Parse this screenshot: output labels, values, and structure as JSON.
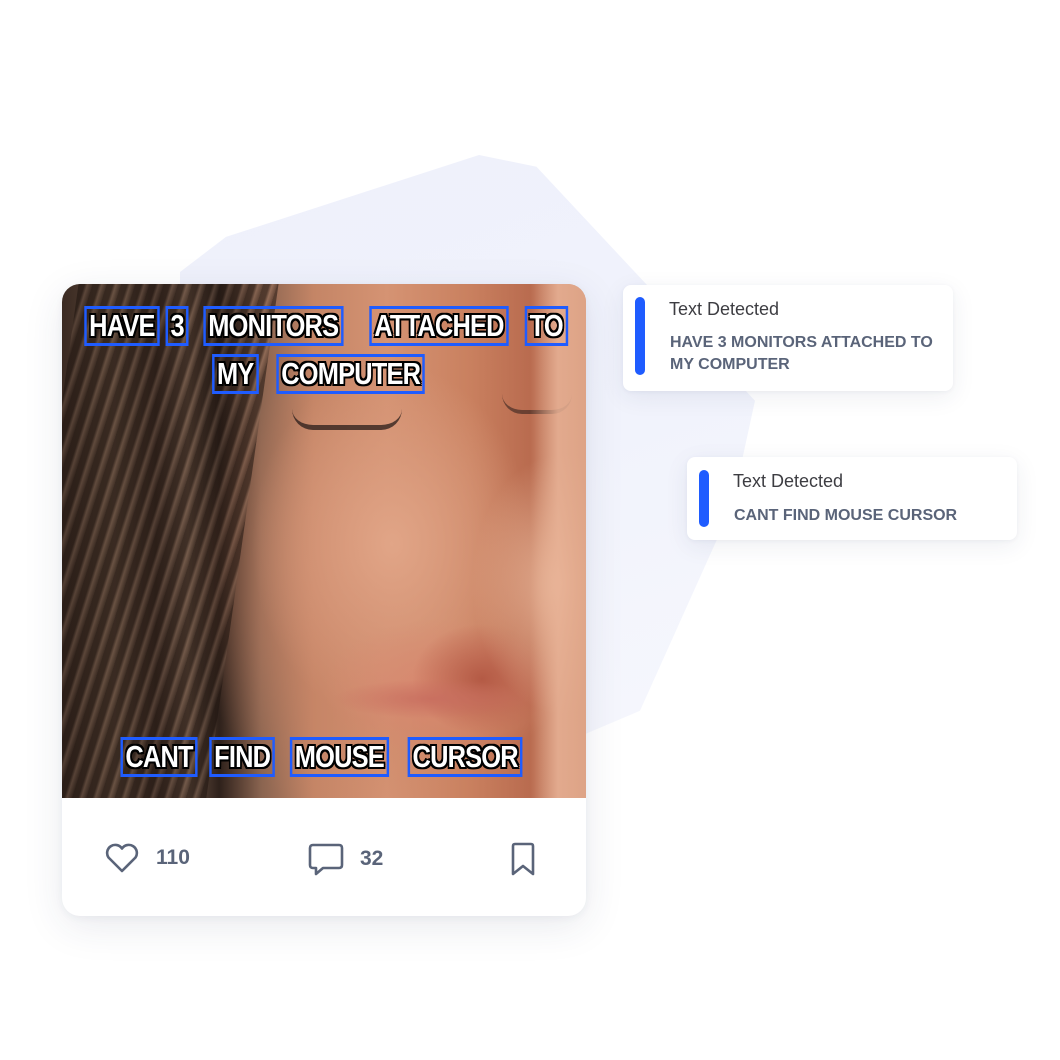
{
  "post": {
    "meme_lines": [
      [
        "HAVE",
        "3",
        "MONITORS",
        "ATTACHED",
        "TO"
      ],
      [
        "MY",
        "COMPUTER"
      ],
      [
        "CANT",
        "FIND",
        "MOUSE",
        "CURSOR"
      ]
    ],
    "actions": {
      "like_icon": "heart-icon",
      "likes": "110",
      "comment_icon": "speech-bubble-icon",
      "comments": "32",
      "bookmark_icon": "bookmark-icon"
    }
  },
  "detections": [
    {
      "title": "Text Detected",
      "text": "HAVE 3 MONITORS ATTACHED TO MY COMPUTER"
    },
    {
      "title": "Text Detected",
      "text": "CANT FIND MOUSE CURSOR"
    }
  ],
  "colors": {
    "accent": "#1f5cff",
    "muted_text": "#5a6479",
    "title_text": "#3d3d42",
    "background_shape": "#eef0fb"
  }
}
